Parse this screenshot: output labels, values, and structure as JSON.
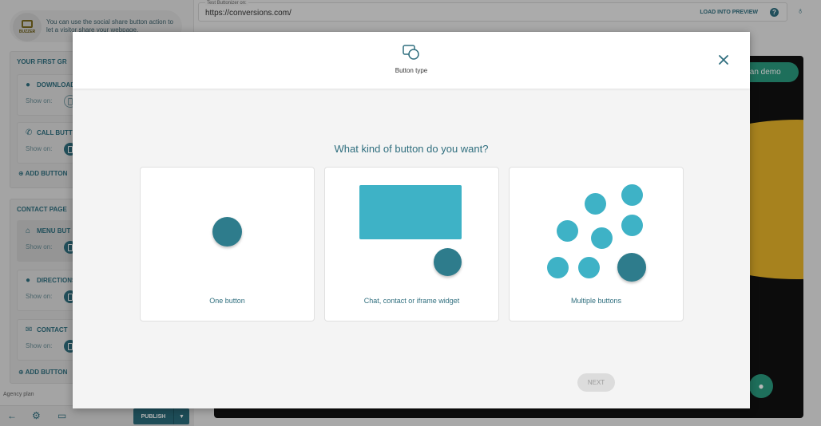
{
  "sidebar": {
    "hint_text": "You can use the social share button action to let a visitor share your webpage.",
    "logo_text": "BUZZER",
    "groups": [
      {
        "title": "YOUR FIRST GR",
        "items": [
          {
            "title": "DOWNLOAD",
            "show_on": "Show on:"
          },
          {
            "title": "CALL BUTT",
            "show_on": "Show on:"
          }
        ],
        "add_label": "ADD BUTTON"
      },
      {
        "title": "CONTACT PAGE",
        "items": [
          {
            "title": "MENU BUT",
            "show_on": "Show on:"
          },
          {
            "title": "DIRECTIONS",
            "show_on": "Show on:"
          },
          {
            "title": "CONTACT",
            "show_on": "Show on:"
          }
        ],
        "add_label": "ADD BUTTON"
      }
    ],
    "plan": "Agency plan",
    "publish_label": "PUBLISH"
  },
  "topbar": {
    "label": "Test Buttonizer on:",
    "url": "https://conversions.com/",
    "load_label": "LOAD INTO PREVIEW",
    "help": "?"
  },
  "preview": {
    "demo_label": "tan demo"
  },
  "modal": {
    "header_label": "Button type",
    "question": "What kind of button do you want?",
    "cards": [
      {
        "label": "One button"
      },
      {
        "label": "Chat, contact or iframe widget"
      },
      {
        "label": "Multiple buttons"
      }
    ],
    "next_label": "NEXT"
  },
  "colors": {
    "primary": "#2f6e7e",
    "accent_light": "#3eb2c6",
    "accent_dark": "#2e7c8c",
    "green": "#2a9a7f"
  }
}
